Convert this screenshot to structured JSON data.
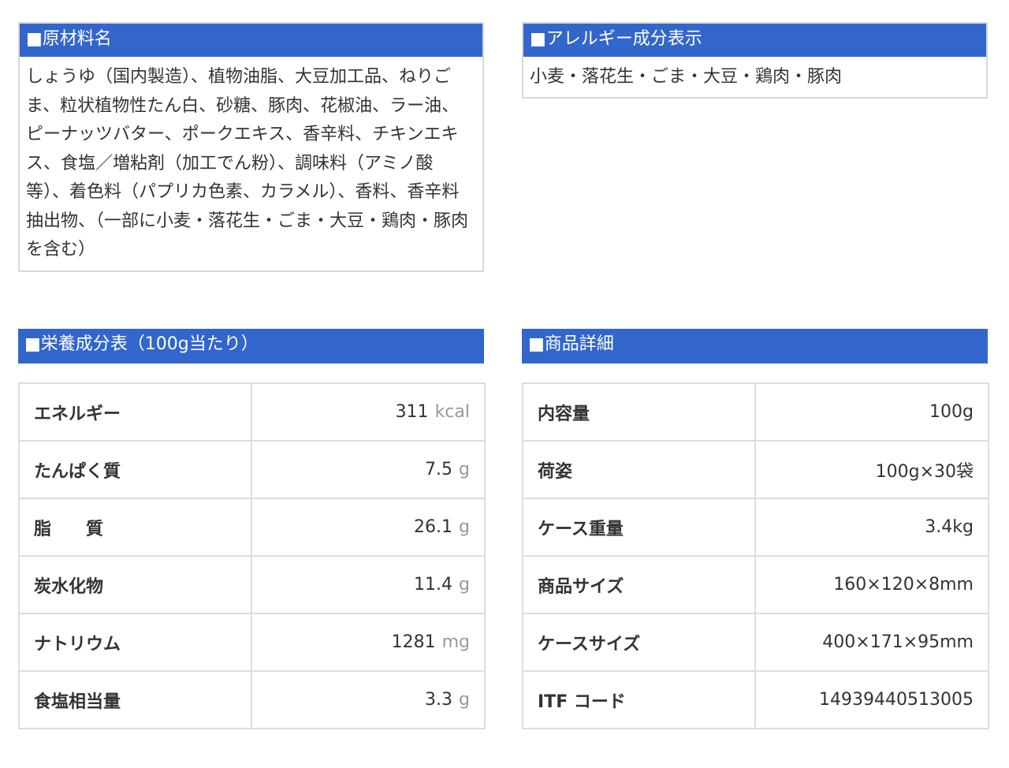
{
  "ingredients": {
    "header": "■原材料名",
    "text": "しょうゆ（国内製造）、植物油脂、大豆加工品、ねりごま、粒状植物性たん白、砂糖、豚肉、花椒油、ラー油、ピーナッツバター、ポークエキス、香辛料、チキンエキス、食塩／増粘剤（加工でん粉）、調味料（アミノ酸等）、着色料（パプリカ色素、カラメル）、香料、香辛料抽出物、（一部に小麦・落花生・ごま・大豆・鶏肉・豚肉を含む）"
  },
  "allergens": {
    "header": "■アレルギー成分表示",
    "text": "小麦・落花生・ごま・大豆・鶏肉・豚肉"
  },
  "nutrition": {
    "header": "■栄養成分表（100g当たり）",
    "rows": [
      {
        "label": "エネルギー",
        "value": "311",
        "unit": "kcal"
      },
      {
        "label": "たんぱく質",
        "value": "7.5",
        "unit": "g"
      },
      {
        "label": "脂　　質",
        "value": "26.1",
        "unit": "g"
      },
      {
        "label": "炭水化物",
        "value": "11.4",
        "unit": "g"
      },
      {
        "label": "ナトリウム",
        "value": "1281",
        "unit": "mg"
      },
      {
        "label": "食塩相当量",
        "value": "3.3",
        "unit": "g"
      }
    ]
  },
  "details": {
    "header": "■商品詳細",
    "rows": [
      {
        "label": "内容量",
        "value": "100g"
      },
      {
        "label": "荷姿",
        "value": "100g×30袋"
      },
      {
        "label": "ケース重量",
        "value": "3.4kg"
      },
      {
        "label": "商品サイズ",
        "value": "160×120×8mm"
      },
      {
        "label": "ケースサイズ",
        "value": "400×171×95mm"
      },
      {
        "label": "ITF コード",
        "value": "14939440513005"
      }
    ]
  },
  "colors": {
    "header_bg": "#3366cc",
    "border": "#dddddd",
    "unit_text": "#999999"
  }
}
